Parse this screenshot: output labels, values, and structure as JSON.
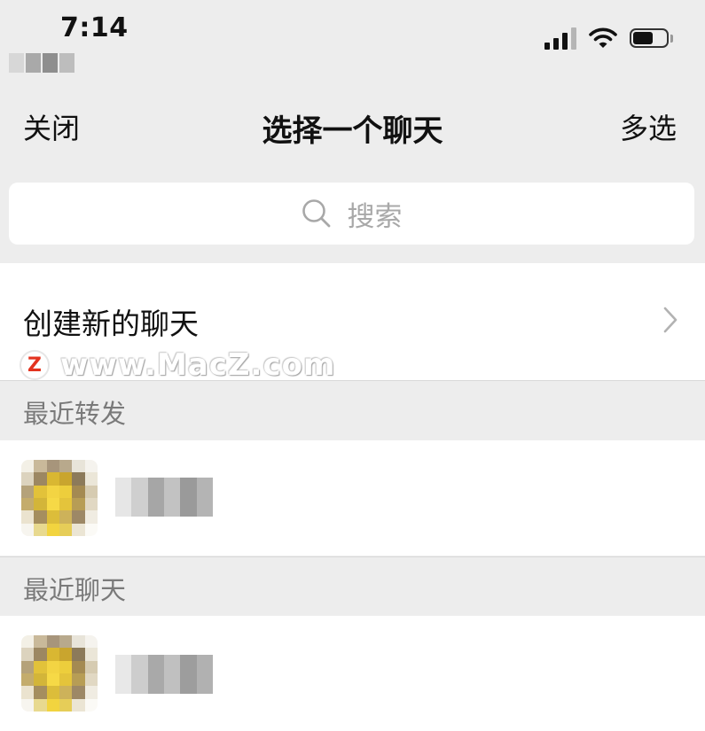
{
  "status_bar": {
    "time": "7:14"
  },
  "nav": {
    "close_label": "关闭",
    "title": "选择一个聊天",
    "multi_select_label": "多选"
  },
  "search": {
    "placeholder": "搜索"
  },
  "create_chat": {
    "label": "创建新的聊天"
  },
  "watermark": {
    "text": "www.MacZ.com",
    "logo_letter": "Z"
  },
  "sections": {
    "recent_forward": {
      "title": "最近转发"
    },
    "recent_chats": {
      "title": "最近聊天"
    }
  },
  "icons": [
    "signal-icon",
    "wifi-icon",
    "battery-icon",
    "search-icon",
    "chevron-right-icon"
  ],
  "colors": {
    "background": "#ededed",
    "row_background": "#ffffff",
    "placeholder": "#a8a8a8",
    "section_text": "#7a7a7a",
    "watermark_logo": "#e3331f"
  }
}
